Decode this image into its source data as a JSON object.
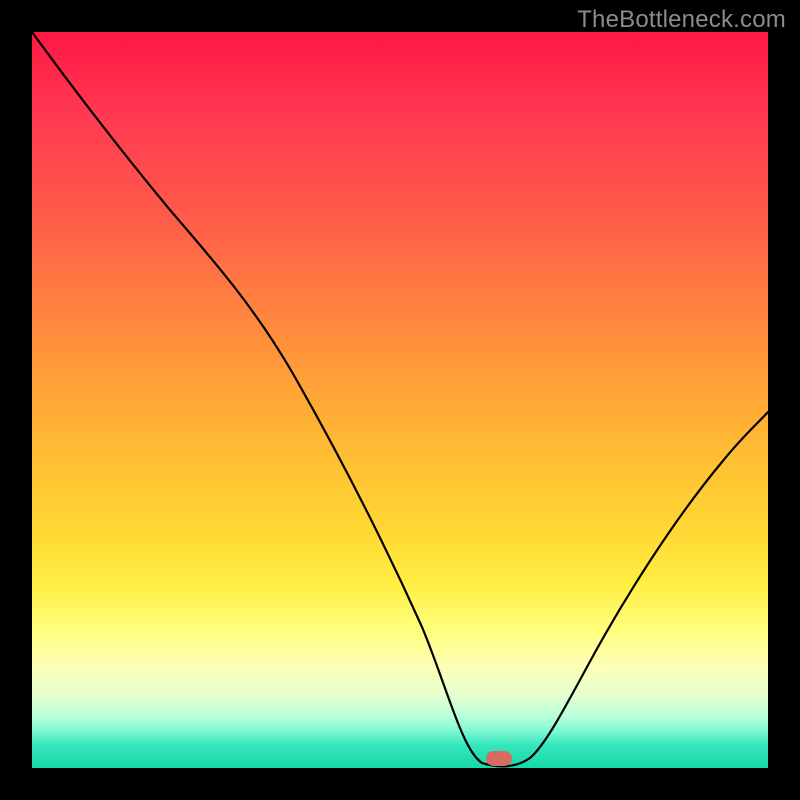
{
  "watermark": "TheBottleneck.com",
  "chart_data": {
    "type": "line",
    "title": "",
    "xlabel": "",
    "ylabel": "",
    "xlim": [
      0,
      1
    ],
    "ylim": [
      0,
      100
    ],
    "background": "rainbow-gradient-red-to-green",
    "marker": {
      "x": 0.63,
      "y": 1.5,
      "color": "#d86a60"
    },
    "series": [
      {
        "name": "bottleneck-curve",
        "color": "#000000",
        "x": [
          0.0,
          0.06,
          0.12,
          0.18,
          0.24,
          0.3,
          0.35,
          0.4,
          0.46,
          0.52,
          0.57,
          0.6,
          0.66,
          0.68,
          0.73,
          0.8,
          0.87,
          0.94,
          1.0
        ],
        "y": [
          100.0,
          92.0,
          84.0,
          76.5,
          69.5,
          63.0,
          55.0,
          47.0,
          37.0,
          27.0,
          15.0,
          6.0,
          0.5,
          2.5,
          10.0,
          22.0,
          34.0,
          45.0,
          55.0
        ]
      }
    ]
  }
}
